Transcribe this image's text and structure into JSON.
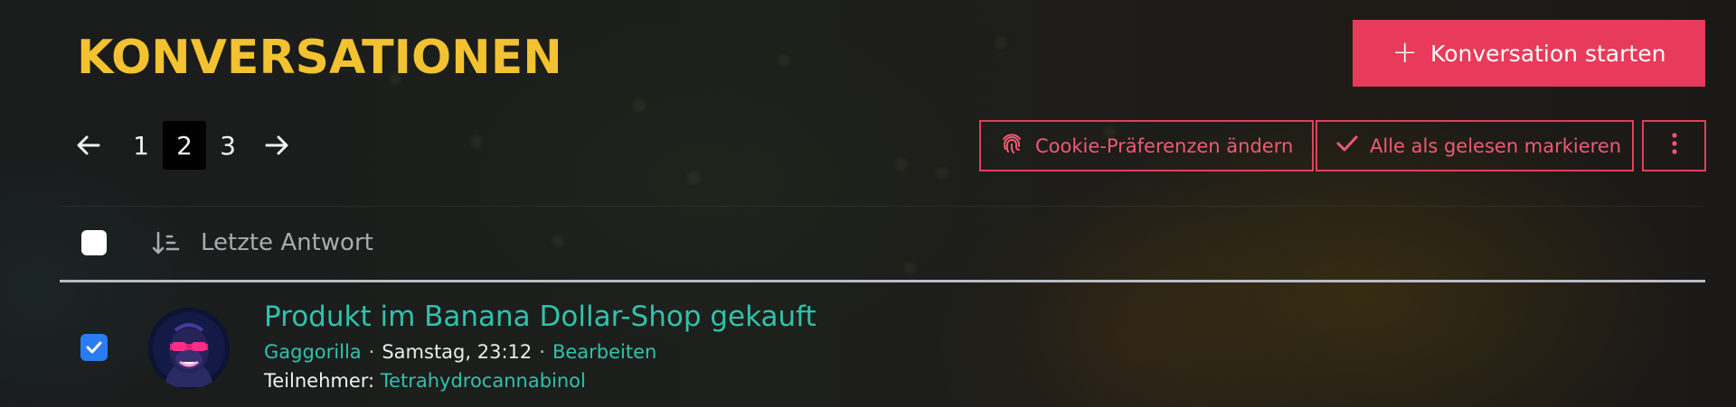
{
  "page": {
    "title": "KONVERSATIONEN"
  },
  "actions": {
    "start_label": "Konversation starten",
    "cookie_label": "Cookie-Präferenzen ändern",
    "mark_read_label": "Alle als gelesen markieren"
  },
  "pagination": {
    "pages": [
      "1",
      "2",
      "3"
    ],
    "current": "2"
  },
  "list_header": {
    "sort_label": "Letzte Antwort"
  },
  "conversations": [
    {
      "title": "Produkt im Banana Dollar-Shop gekauft",
      "author": "Gaggorilla",
      "time": "Samstag, 23:12",
      "edit_label": "Bearbeiten",
      "participants_label": "Teilnehmer:",
      "participant": "Tetrahydrocannabinol",
      "selected": true
    }
  ],
  "colors": {
    "title": "#f2c230",
    "accent": "#e83a5a",
    "link": "#2fc2ad",
    "checkbox": "#2a7cf3"
  },
  "icons": [
    "arrow-left-icon",
    "arrow-right-icon",
    "plus-icon",
    "fingerprint-icon",
    "check-icon",
    "more-vertical-icon",
    "sort-descending-icon",
    "checkmark-icon"
  ]
}
